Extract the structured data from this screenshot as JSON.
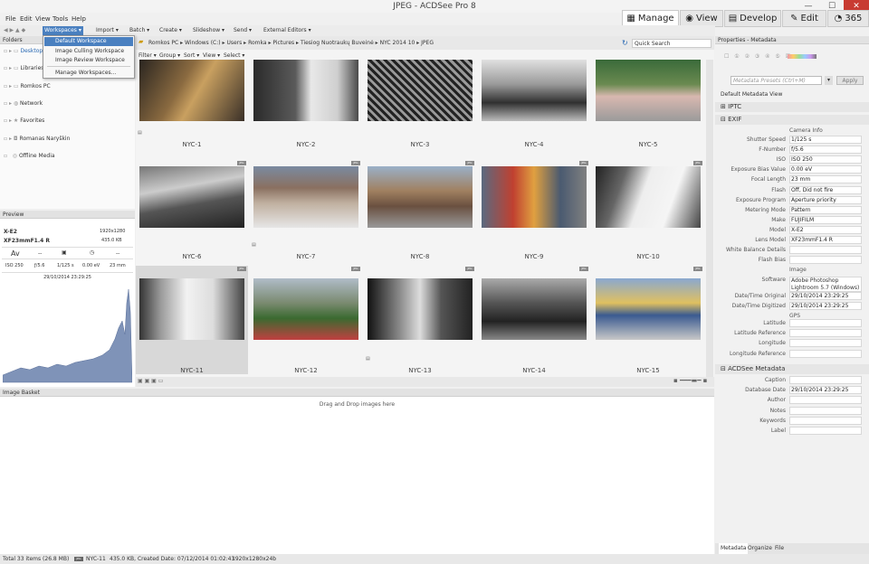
{
  "window": {
    "title": "JPEG - ACDSee Pro 8",
    "minimize": "—",
    "maximize": "☐",
    "close": "✕"
  },
  "menu": [
    "File",
    "Edit",
    "View",
    "Tools",
    "Help"
  ],
  "modes": [
    {
      "label": "Manage",
      "icon": "▦"
    },
    {
      "label": "View",
      "icon": "◉"
    },
    {
      "label": "Develop",
      "icon": "▤"
    },
    {
      "label": "Edit",
      "icon": "✎"
    },
    {
      "label": "365",
      "icon": "◔"
    }
  ],
  "toolbar": {
    "items": [
      "Workspaces ▾",
      "Import ▾",
      "Batch ▾",
      "Create ▾",
      "Slideshow ▾",
      "Send ▾",
      "External Editors ▾"
    ]
  },
  "workspaces_menu": [
    "Default Workspace",
    "Image Culling Workspace",
    "Image Review Workspace",
    "Manage Workspaces..."
  ],
  "folders": {
    "title": "Folders",
    "items": [
      "Desktop",
      "Libraries",
      "Romkos PC",
      "Network",
      "Favorites",
      "Romanas Naryškin",
      "Offline Media"
    ]
  },
  "breadcrumb": [
    "Romkos PC",
    "Windows (C:)",
    "Users",
    "Romka",
    "Pictures",
    "Tiesiog Nuotraukų Buveinė",
    "NYC 2014 10",
    "JPEG"
  ],
  "quick_search": "Quick Search",
  "filter_bar": [
    "Filter ▾",
    "Group ▾",
    "Sort ▾",
    "View ▾",
    "Select ▾"
  ],
  "thumbnails": [
    "NYC-1",
    "NYC-2",
    "NYC-3",
    "NYC-4",
    "NYC-5",
    "NYC-6",
    "NYC-7",
    "NYC-8",
    "NYC-9",
    "NYC-10",
    "NYC-11",
    "NYC-12",
    "NYC-13",
    "NYC-14",
    "NYC-15"
  ],
  "jpg_badge": "JPG",
  "preview": {
    "title": "Preview",
    "camera": "X-E2",
    "dims": "1920x1280",
    "lens": "XF23mmF1.4 R",
    "size": "435.0 KB",
    "mode": "Av",
    "dash1": "--",
    "dash2": "--",
    "iso": "ISO 250",
    "aperture": "ƒ/5.6",
    "shutter": "1/125 s",
    "ev": "0.00 eV",
    "focal": "23 mm",
    "date": "29/10/2014 23:29:25"
  },
  "basket": {
    "title": "Image Basket",
    "hint": "Drag and Drop images here"
  },
  "properties": {
    "title": "Properties - Metadata",
    "presets": "Metadata Presets (Ctrl+M)",
    "apply": "Apply",
    "view": "Default Metadata View",
    "iptc": "IPTC",
    "exif": "EXIF",
    "camera_info": "Camera Info",
    "exif_rows": [
      [
        "Shutter Speed",
        "1/125 s"
      ],
      [
        "F-Number",
        "f/5.6"
      ],
      [
        "ISO",
        "ISO 250"
      ],
      [
        "Exposure Bias Value",
        "0.00 eV"
      ],
      [
        "Focal Length",
        "23 mm"
      ],
      [
        "Flash",
        "Off, Did not fire"
      ],
      [
        "Exposure Program",
        "Aperture priority"
      ],
      [
        "Metering Mode",
        "Pattern"
      ],
      [
        "Make",
        "FUJIFILM"
      ],
      [
        "Model",
        "X-E2"
      ],
      [
        "Lens Model",
        "XF23mmF1.4 R"
      ],
      [
        "White Balance Details",
        ""
      ],
      [
        "Flash Bias",
        ""
      ]
    ],
    "image": "Image",
    "image_rows": [
      [
        "Software",
        "Adobe Photoshop Lightroom 5.7 (Windows)"
      ],
      [
        "Date/Time Original",
        "29/10/2014 23:29:25"
      ],
      [
        "Date/Time Digitized",
        "29/10/2014 23:29:25"
      ]
    ],
    "gps": "GPS",
    "gps_rows": [
      [
        "Latitude",
        ""
      ],
      [
        "Latitude Reference",
        ""
      ],
      [
        "Longitude",
        ""
      ],
      [
        "Longitude Reference",
        ""
      ]
    ],
    "acdsee": "ACDSee Metadata",
    "acd_rows": [
      [
        "Caption",
        ""
      ],
      [
        "Database Date",
        "29/10/2014 23:29:25"
      ],
      [
        "Author",
        ""
      ],
      [
        "Notes",
        ""
      ],
      [
        "Keywords",
        ""
      ],
      [
        "Label",
        ""
      ]
    ],
    "tabs": [
      "Metadata",
      "Organize",
      "File"
    ]
  },
  "status": {
    "total": "Total 33 items  (26.8 MB)",
    "badge": "JPG",
    "file": "NYC-11",
    "info": "435.0 KB, Created Date: 07/12/2014 01:02:43",
    "dims": "1920x1280x24b"
  }
}
